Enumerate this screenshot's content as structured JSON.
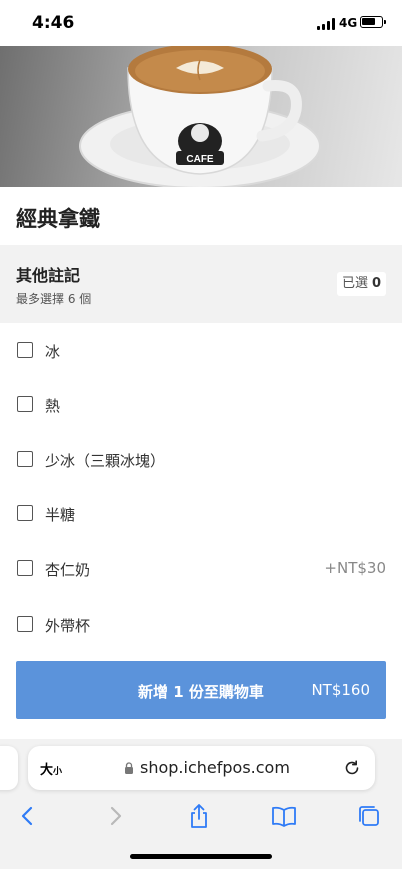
{
  "status_bar": {
    "time": "4:46",
    "network": "4G",
    "battery_level": 0.7
  },
  "product": {
    "title": "經典拿鐵",
    "cup_text": "CAFE"
  },
  "options": {
    "title": "其他註記",
    "subtitle": "最多選擇 6 個",
    "selected_label": "已選",
    "selected_count": "0",
    "items": [
      {
        "label": "冰",
        "price": "",
        "checked": false
      },
      {
        "label": "熱",
        "price": "",
        "checked": false
      },
      {
        "label": "少冰（三顆冰塊）",
        "price": "",
        "checked": false
      },
      {
        "label": "半糖",
        "price": "",
        "checked": false
      },
      {
        "label": "杏仁奶",
        "price": "+NT$30",
        "checked": false
      },
      {
        "label": "外帶杯",
        "price": "",
        "checked": false
      }
    ]
  },
  "cart_button": {
    "label": "新增 1 份至購物車",
    "price": "NT$160"
  },
  "browser": {
    "text_size_label": "大",
    "text_size_small": "小",
    "url": "shop.ichefpos.com"
  },
  "colors": {
    "accent": "#5b93db",
    "ios_blue": "#2f7bf6"
  }
}
